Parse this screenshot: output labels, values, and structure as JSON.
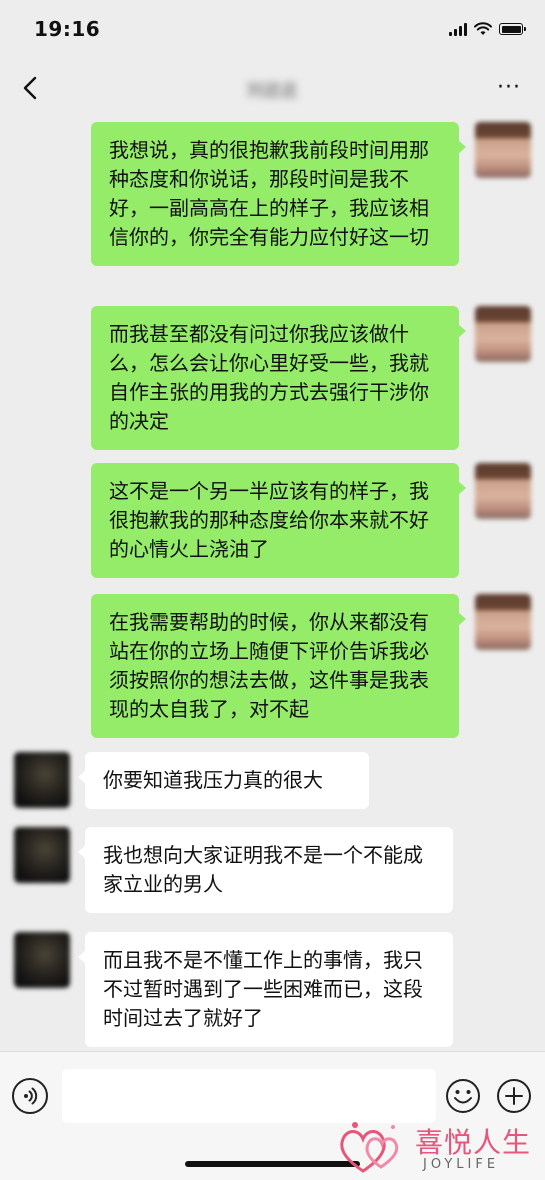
{
  "status_bar": {
    "time": "19:16"
  },
  "nav": {
    "title": "刘这这",
    "back_icon": "chevron-left-icon",
    "more_icon": "more-dots-icon",
    "more_label": "···"
  },
  "messages": [
    {
      "side": "me",
      "text": "我想说，真的很抱歉我前段时间用那种态度和你说话，那段时间是我不好，一副高高在上的样子，我应该相信你的，你完全有能力应付好这一切"
    },
    {
      "side": "me",
      "text": "而我甚至都没有问过你我应该做什么，怎么会让你心里好受一些，我就自作主张的用我的方式去强行干涉你的决定"
    },
    {
      "side": "me",
      "text": "这不是一个另一半应该有的样子，我很抱歉我的那种态度给你本来就不好的心情火上浇油了"
    },
    {
      "side": "me",
      "text": "在我需要帮助的时候，你从来都没有站在你的立场上随便下评价告诉我必须按照你的想法去做，这件事是我表现的太自我了，对不起"
    },
    {
      "side": "peer",
      "text": "你要知道我压力真的很大"
    },
    {
      "side": "peer",
      "text": "我也想向大家证明我不是一个不能成家立业的男人"
    },
    {
      "side": "peer",
      "text": "而且我不是不懂工作上的事情，我只不过暂时遇到了一些困难而已，这段时间过去了就好了"
    }
  ],
  "input_bar": {
    "placeholder": ""
  },
  "watermark": {
    "name": "喜悦人生",
    "sub": "JOYLIFE"
  },
  "colors": {
    "my_bubble": "#95ec69",
    "peer_bubble": "#ffffff",
    "background": "#ededed",
    "watermark": "#e8557a"
  }
}
